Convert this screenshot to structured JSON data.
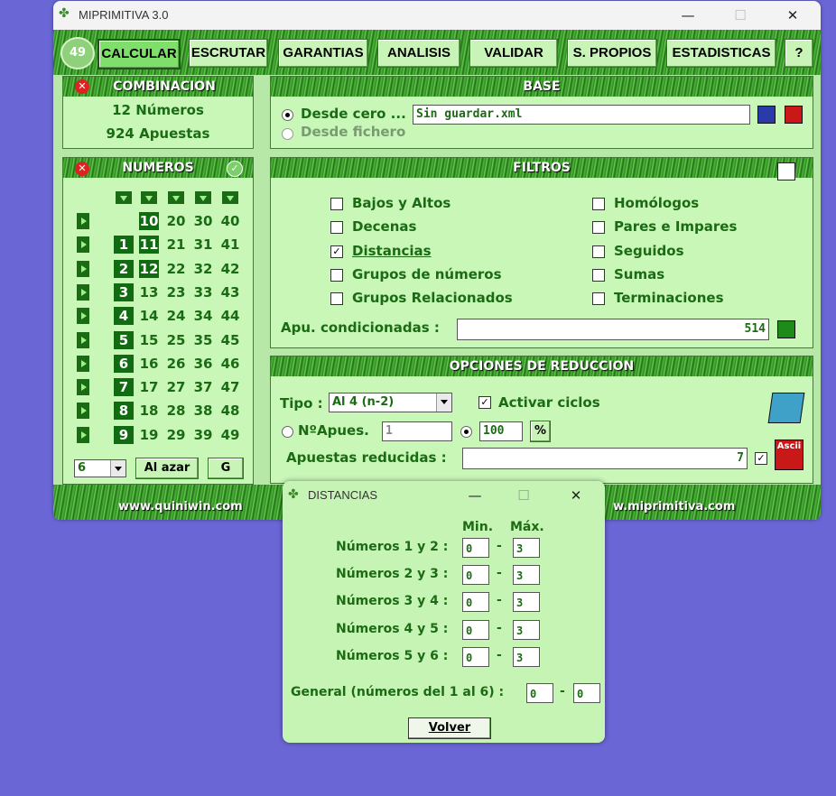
{
  "main": {
    "title": "MIPRIMITIVA 3.0",
    "logo_number": "49",
    "nav": [
      "CALCULAR",
      "ESCRUTAR",
      "GARANTIAS",
      "ANALISIS",
      "VALIDAR",
      "S. PROPIOS",
      "ESTADISTICAS",
      "?"
    ],
    "combinacion": {
      "title": "COMBINACION",
      "numeros": "12 Números",
      "apuestas": "924 Apuestas"
    },
    "numeros": {
      "title": "NUMEROS",
      "rows": [
        [
          "",
          "10",
          "20",
          "30",
          "40"
        ],
        [
          "1",
          "11",
          "21",
          "31",
          "41"
        ],
        [
          "2",
          "12",
          "22",
          "32",
          "42"
        ],
        [
          "3",
          "13",
          "23",
          "33",
          "43"
        ],
        [
          "4",
          "14",
          "24",
          "34",
          "44"
        ],
        [
          "5",
          "15",
          "25",
          "35",
          "45"
        ],
        [
          "6",
          "16",
          "26",
          "36",
          "46"
        ],
        [
          "7",
          "17",
          "27",
          "37",
          "47"
        ],
        [
          "8",
          "18",
          "28",
          "38",
          "48"
        ],
        [
          "9",
          "19",
          "29",
          "39",
          "49"
        ]
      ],
      "selected": [
        "1",
        "2",
        "3",
        "4",
        "5",
        "6",
        "7",
        "8",
        "9",
        "10",
        "11",
        "12"
      ],
      "select_value": "6",
      "random_button": "Al azar",
      "g_button": "G"
    },
    "base": {
      "title": "BASE",
      "option1": "Desde cero ...",
      "option2": "Desde fichero",
      "file_value": "Sin guardar.xml"
    },
    "filtros": {
      "title": "FILTROS",
      "left": [
        {
          "label": "Bajos y Altos",
          "checked": false
        },
        {
          "label": "Decenas",
          "checked": false
        },
        {
          "label": "Distancias",
          "checked": true
        },
        {
          "label": "Grupos de números",
          "checked": false
        },
        {
          "label": "Grupos Relacionados",
          "checked": false
        }
      ],
      "right": [
        {
          "label": "Homólogos",
          "checked": false
        },
        {
          "label": "Pares e Impares",
          "checked": false
        },
        {
          "label": "Seguidos",
          "checked": false
        },
        {
          "label": "Sumas",
          "checked": false
        },
        {
          "label": "Terminaciones",
          "checked": false
        }
      ],
      "cond_label": "Apu. condicionadas :",
      "cond_value": "514"
    },
    "opciones": {
      "title": "OPCIONES DE REDUCCION",
      "tipo_label": "Tipo :",
      "tipo_value": "Al 4 (n-2)",
      "ciclos_label": "Activar ciclos",
      "napues_label": "NºApues.",
      "napues_value": "1",
      "percent_value": "100",
      "percent_sign": "%",
      "reducidas_label": "Apuestas reducidas :",
      "reducidas_value": "7",
      "ascii_label": "Ascii"
    },
    "footer": {
      "left": "www.quiniwin.com",
      "right": "w.miprimitiva.com"
    }
  },
  "dialog": {
    "title": "DISTANCIAS",
    "min_header": "Min.",
    "max_header": "Máx.",
    "rows": [
      {
        "label": "Números 1 y 2 :",
        "min": "0",
        "max": "3"
      },
      {
        "label": "Números 2 y 3 :",
        "min": "0",
        "max": "3"
      },
      {
        "label": "Números 3 y 4 :",
        "min": "0",
        "max": "3"
      },
      {
        "label": "Números 4 y 5 :",
        "min": "0",
        "max": "3"
      },
      {
        "label": "Números 5 y 6 :",
        "min": "0",
        "max": "3"
      }
    ],
    "general_label": "General (números del 1 al 6) :",
    "general_min": "0",
    "general_max": "0",
    "dash": "-",
    "volver": "Volver"
  }
}
